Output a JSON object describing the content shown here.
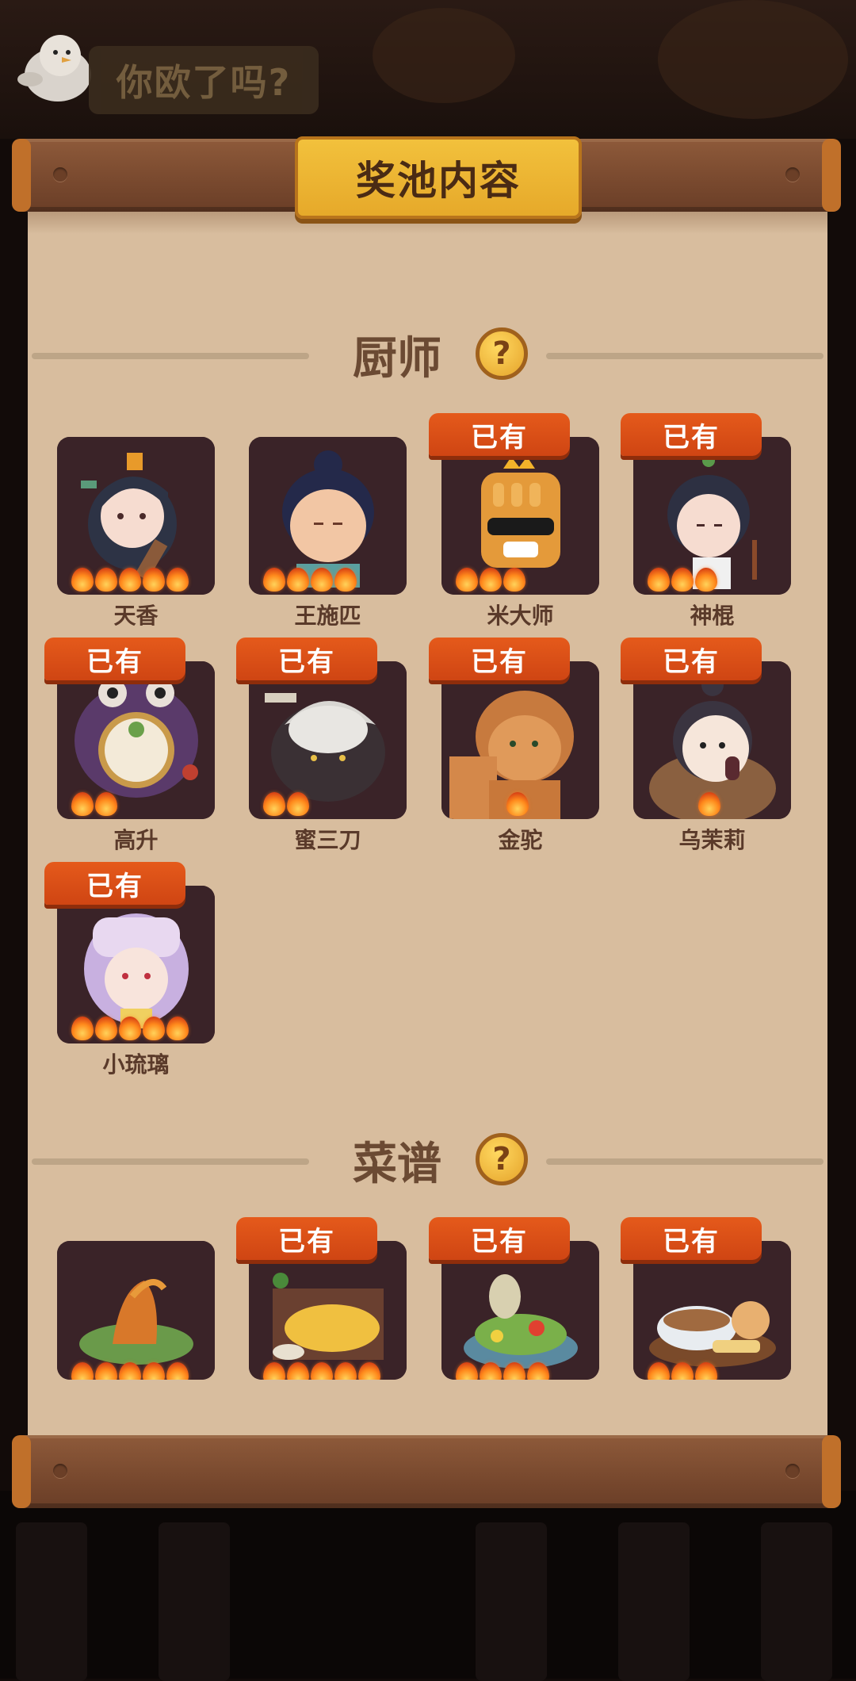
{
  "background": {
    "top_title": "你欧了吗?"
  },
  "header": {
    "title": "奖池内容"
  },
  "owned_label": "已有",
  "chefs": {
    "heading": "厨师",
    "help_symbol": "?",
    "items": [
      {
        "name": "天香",
        "stars": 5,
        "owned": false
      },
      {
        "name": "王施匹",
        "stars": 4,
        "owned": false
      },
      {
        "name": "米大师",
        "stars": 3,
        "owned": true
      },
      {
        "name": "神棍",
        "stars": 3,
        "owned": true
      },
      {
        "name": "高升",
        "stars": 2,
        "owned": true
      },
      {
        "name": "蜜三刀",
        "stars": 2,
        "owned": true
      },
      {
        "name": "金驼",
        "stars": 1,
        "owned": true
      },
      {
        "name": "乌茉莉",
        "stars": 1,
        "owned": true
      },
      {
        "name": "小琉璃",
        "stars": 5,
        "owned": true
      }
    ]
  },
  "recipes": {
    "heading": "菜谱",
    "help_symbol": "?",
    "items": [
      {
        "stars": 5,
        "owned": false
      },
      {
        "stars": 5,
        "owned": true
      },
      {
        "stars": 4,
        "owned": true
      },
      {
        "stars": 3,
        "owned": true
      }
    ]
  },
  "colors": {
    "owned_badge": "#d84a16",
    "card_bg": "#3a2328",
    "paper": "#d8bd9e",
    "plaque": "#e9b02f"
  }
}
